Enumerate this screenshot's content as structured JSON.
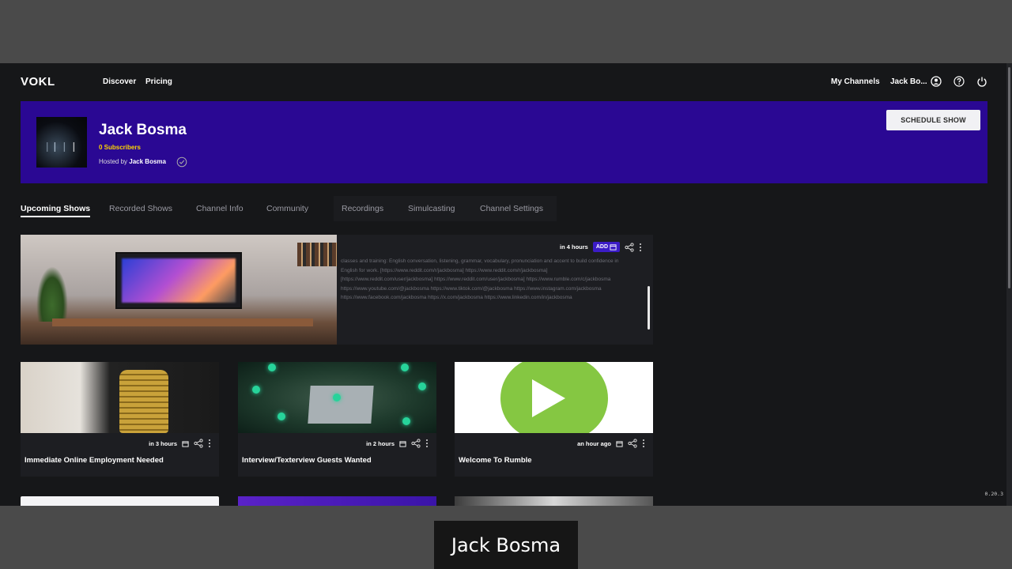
{
  "app": {
    "logo": "VOKL",
    "nav": [
      {
        "label": "Discover"
      },
      {
        "label": "Pricing"
      }
    ],
    "right": {
      "my_channels": "My Channels",
      "user_name": "Jack Bo..."
    }
  },
  "channel": {
    "title": "Jack Bosma",
    "subscribers": "0 Subscribers",
    "hosted_prefix": "Hosted by",
    "host_name": "Jack Bosma",
    "schedule_button": "SCHEDULE SHOW"
  },
  "tabs": [
    {
      "label": "Upcoming Shows",
      "active": true
    },
    {
      "label": "Recorded Shows",
      "active": false
    },
    {
      "label": "Channel Info",
      "active": false
    },
    {
      "label": "Community",
      "active": false
    },
    {
      "label": "Recordings",
      "active": false
    },
    {
      "label": "Simulcasting",
      "active": false
    },
    {
      "label": "Channel Settings",
      "active": false
    }
  ],
  "featured": {
    "time": "in 4 hours",
    "add_label": "ADD",
    "description": "classes and training: English conversation, listening, grammar, vocabulary, pronunciation and accent to build confidence in English for work. [https://www.reddit.com/r/jackbosma] https://www.reddit.com/r/jackbosma] [https://www.reddit.com/user/jackbosma] https://www.reddit.com/user/jackbosma] https://www.rumble.com/c/jackbosma https://www.youtube.com/@jackbosma https://www.tiktok.com/@jackbosma https://www.instagram.com/jackbosma https://www.facebook.com/jackbosma https://x.com/jackbosma https://www.linkedin.com/in/jackbosma"
  },
  "cards": [
    {
      "title": "Immediate Online Employment Needed",
      "time": "in 3 hours"
    },
    {
      "title": "Interview/Texterview Guests Wanted",
      "time": "in 2 hours"
    },
    {
      "title": "Welcome To Rumble",
      "time": "an hour ago"
    }
  ],
  "version": "0.20.3",
  "caption": "Jack Bosma",
  "colors": {
    "banner": "#2a0893",
    "accent": "#3b1cc6",
    "subscribers": "#ffd500",
    "rumble": "#85c742"
  }
}
